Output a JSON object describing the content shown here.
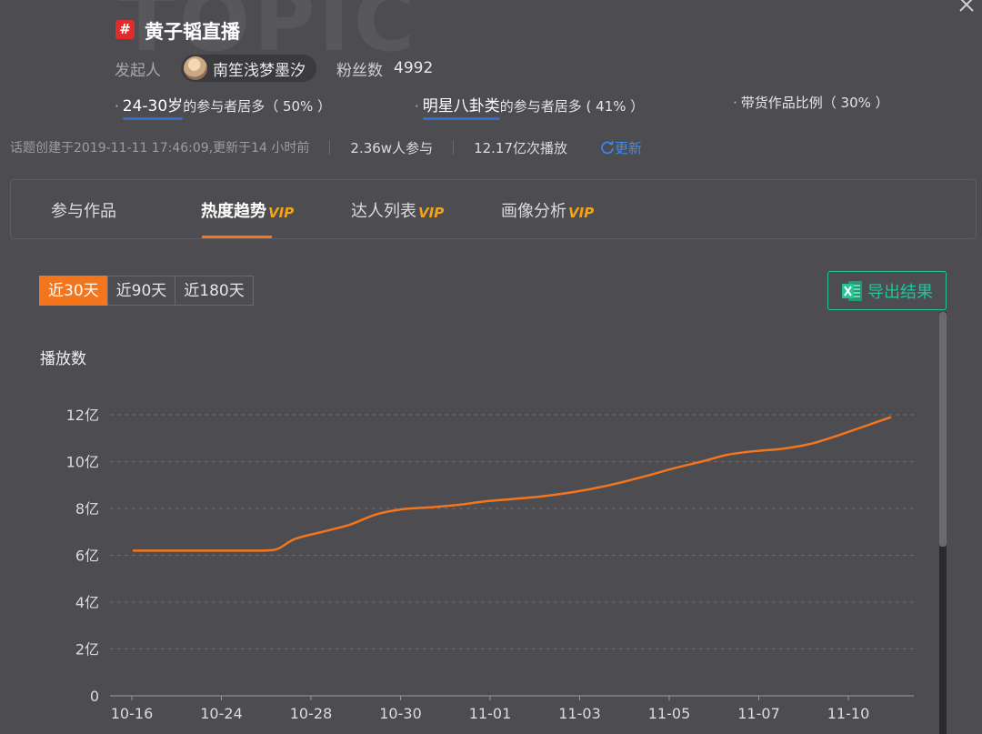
{
  "watermark": "TOPIC",
  "topic": {
    "badge": "#",
    "title": "黄子韬直播"
  },
  "creator": {
    "label": "发起人",
    "name": "南笙浅梦墨汐"
  },
  "fans": {
    "label": "粉丝数",
    "value": "4992"
  },
  "stats": [
    {
      "highlight": "24-30岁",
      "text": "的参与者居多（ 50% ）"
    },
    {
      "highlight": "明星八卦类",
      "text": "的参与者居多 ( 41% ）"
    },
    {
      "highlight": "",
      "text": "带货作品比例（ 30% ）"
    }
  ],
  "meta": {
    "created": "话题创建于2019-11-11 17:46:09,更新于14 小时前",
    "participants": "2.36w人参与",
    "plays": "12.17亿次播放",
    "refresh": "更新"
  },
  "tabs": [
    {
      "label": "参与作品",
      "vip": ""
    },
    {
      "label": "热度趋势",
      "vip": "VIP"
    },
    {
      "label": "达人列表",
      "vip": "VIP"
    },
    {
      "label": "画像分析",
      "vip": "VIP"
    }
  ],
  "active_tab": "热度趋势",
  "ranges": [
    "近30天",
    "近90天",
    "近180天"
  ],
  "active_range": "近30天",
  "export_label": "导出结果",
  "colors": {
    "accent": "#f3751e",
    "export": "#26c29a",
    "link": "#3d8af1",
    "vip": "#f2a317"
  },
  "chart_data": {
    "type": "line",
    "ylabel": "播放数",
    "ylim": [
      0,
      12
    ],
    "yticks": [
      "0",
      "2亿",
      "4亿",
      "6亿",
      "8亿",
      "10亿",
      "12亿"
    ],
    "xticks": [
      "10-16",
      "10-24",
      "10-28",
      "10-30",
      "11-01",
      "11-03",
      "11-05",
      "11-07",
      "11-10"
    ],
    "grid": true,
    "series": [
      {
        "color": "#f3751e",
        "points": [
          [
            0,
            6.2
          ],
          [
            1,
            6.2
          ],
          [
            2,
            6.2
          ],
          [
            3,
            6.2
          ],
          [
            4,
            6.2
          ],
          [
            5,
            6.21
          ],
          [
            5.4,
            6.3
          ],
          [
            6,
            6.7
          ],
          [
            7,
            7.0
          ],
          [
            8,
            7.3
          ],
          [
            9,
            7.75
          ],
          [
            10,
            7.97
          ],
          [
            11,
            8.05
          ],
          [
            12,
            8.15
          ],
          [
            13,
            8.3
          ],
          [
            14,
            8.4
          ],
          [
            15,
            8.5
          ],
          [
            16,
            8.65
          ],
          [
            17,
            8.85
          ],
          [
            18,
            9.1
          ],
          [
            19,
            9.4
          ],
          [
            20,
            9.72
          ],
          [
            21,
            10.0
          ],
          [
            22,
            10.3
          ],
          [
            23,
            10.45
          ],
          [
            24,
            10.55
          ],
          [
            25,
            10.75
          ],
          [
            26,
            11.1
          ],
          [
            27,
            11.5
          ],
          [
            28,
            11.9
          ]
        ]
      }
    ]
  }
}
